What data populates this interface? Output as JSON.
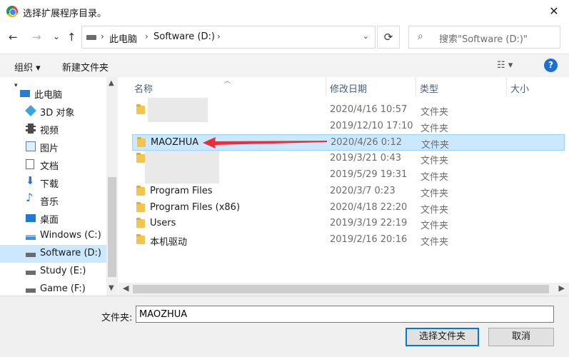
{
  "window": {
    "title": "选择扩展程序目录。",
    "close": "✕"
  },
  "nav": {
    "back": "←",
    "forward": "→",
    "recent": "⌄",
    "up": "↑"
  },
  "address": {
    "crumbs": [
      "此电脑",
      "Software (D:)"
    ],
    "sep": "›",
    "drop": "⌄"
  },
  "refresh": "⟳",
  "search": {
    "placeholder": "搜索\"Software (D:)\"",
    "icon": "⌕"
  },
  "toolbar": {
    "organize": "组织 ▾",
    "new_folder": "新建文件夹",
    "view": "☷ ▾",
    "help": "?"
  },
  "navpane": {
    "expander": "▾",
    "items": [
      {
        "label": "此电脑",
        "icon": "computer-icon"
      },
      {
        "label": "3D 对象",
        "icon": "3d-objects-icon"
      },
      {
        "label": "视频",
        "icon": "video-icon"
      },
      {
        "label": "图片",
        "icon": "picture-icon"
      },
      {
        "label": "文档",
        "icon": "document-icon"
      },
      {
        "label": "下载",
        "icon": "download-icon"
      },
      {
        "label": "音乐",
        "icon": "music-icon"
      },
      {
        "label": "桌面",
        "icon": "desktop-icon"
      },
      {
        "label": "Windows (C:)",
        "icon": "drive-icon"
      },
      {
        "label": "Software (D:)",
        "icon": "drive-icon",
        "selected": true
      },
      {
        "label": "Study (E:)",
        "icon": "drive-icon"
      },
      {
        "label": "Game (F:)",
        "icon": "drive-icon"
      }
    ]
  },
  "columns": {
    "name": "名称",
    "modified": "修改日期",
    "type": "类型",
    "size": "大小"
  },
  "files": [
    {
      "name": "",
      "date": "2020/4/16 10:57",
      "type": "文件夹",
      "blurred": true
    },
    {
      "name": "",
      "date": "2019/12/10 17:10",
      "type": "文件夹",
      "blurred": true
    },
    {
      "name": "MAOZHUA",
      "date": "2020/4/26 0:12",
      "type": "文件夹",
      "selected": true
    },
    {
      "name": "",
      "date": "2019/3/21 0:43",
      "type": "文件夹",
      "blurred": true
    },
    {
      "name": "",
      "date": "2019/5/29 19:31",
      "type": "文件夹",
      "blurred": true
    },
    {
      "name": "Program Files",
      "date": "2020/3/7 0:23",
      "type": "文件夹"
    },
    {
      "name": "Program Files (x86)",
      "date": "2020/4/18 22:20",
      "type": "文件夹"
    },
    {
      "name": "Users",
      "date": "2019/3/19 22:19",
      "type": "文件夹"
    },
    {
      "name": "本机驱动",
      "date": "2019/2/16 20:16",
      "type": "文件夹"
    }
  ],
  "annotation": {
    "color": "#e8303a"
  },
  "footer": {
    "folder_label": "文件夹:",
    "folder_value": "MAOZHUA",
    "select_button": "选择文件夹",
    "cancel_button": "取消"
  },
  "colors": {
    "selection": "#cce8ff",
    "accent": "#0078d7",
    "help": "#1f6fd1"
  }
}
